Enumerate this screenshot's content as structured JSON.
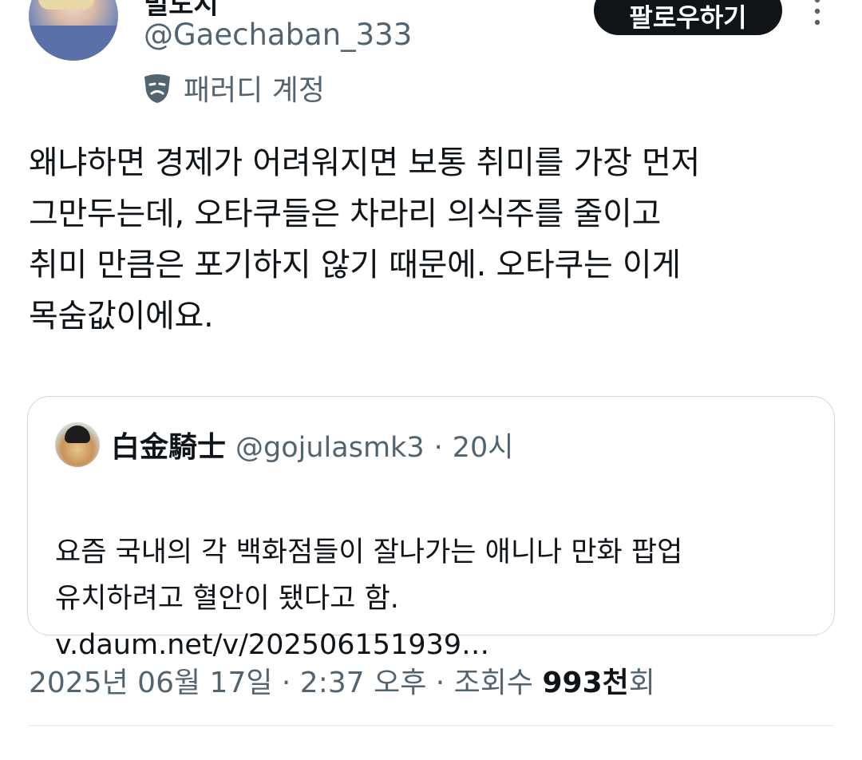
{
  "author": {
    "display_name": "빌도시",
    "handle": "@Gaechaban_333",
    "badge_label": "패러디 계정",
    "badge_icon": "theater-mask-icon"
  },
  "actions": {
    "follow_label": "팔로우하기",
    "more_icon": "more-vertical-icon"
  },
  "tweet": {
    "text": "왜냐하면 경제가 어려워지면 보통 취미를 가장 먼저\n그만두는데, 오타쿠들은 차라리 의식주를 줄이고\n취미 만큼은 포기하지 않기 때문에. 오타쿠는 이게\n목숨값이에요."
  },
  "quote": {
    "display_name": "白金騎士",
    "handle": "@gojulasmk3",
    "separator": "·",
    "time": "20시",
    "text": "요즘 국내의 각 백화점들이 잘나가는 애니나 만화 팝업\n유치하려고 혈안이 됐다고 함.",
    "link": "v.daum.net/v/202506151939…"
  },
  "meta": {
    "datetime": "2025년 06월 17일 · 2:37 오후 · 조회수 ",
    "views_count": "993천",
    "views_suffix": "회"
  },
  "colors": {
    "text_primary": "#0f1419",
    "text_secondary": "#536471",
    "border": "#cfd9de",
    "button_bg": "#0f1419"
  }
}
